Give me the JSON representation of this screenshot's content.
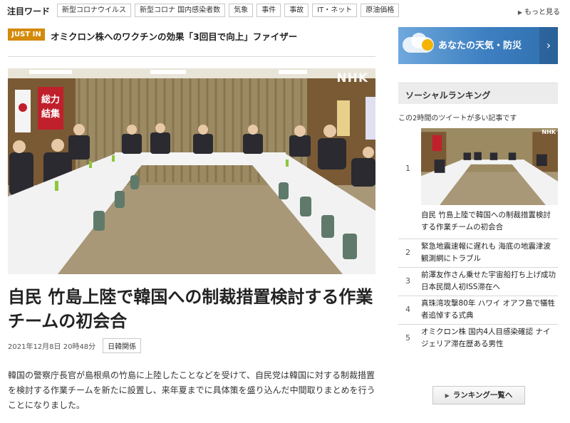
{
  "trending": {
    "label": "注目ワード",
    "tags": [
      "新型コロナウイルス",
      "新型コロナ 国内感染者数",
      "気象",
      "事件",
      "事故",
      "IT・ネット",
      "原油価格"
    ],
    "more": "もっと見る"
  },
  "just_in": {
    "badge": "JUST IN",
    "text": "オミクロン株へのワクチンの効果「3回目で向上」ファイザー"
  },
  "photo": {
    "logo": "NHK",
    "banner_lines": [
      "総力",
      "結集"
    ]
  },
  "article": {
    "headline": "自民 竹島上陸で韓国への制裁措置検討する作業チームの初会合",
    "date": "2021年12月8日 20時48分",
    "category": "日韓関係",
    "body": "韓国の警察庁長官が島根県の竹島に上陸したことなどを受けて、自民党は韓国に対する制裁措置を検討する作業チームを新たに設置し、来年夏までに具体策を盛り込んだ中間取りまとめを行うことになりました。"
  },
  "weather_banner": {
    "text": "あなたの天気・防災",
    "icon": "sun-cloud-icon",
    "arrow_icon": "chevron-right-icon"
  },
  "social_ranking": {
    "heading": "ソーシャルランキング",
    "subheading": "この2時間のツイートが多い記事です",
    "items": [
      {
        "rank": "1",
        "title": "自民 竹島上陸で韓国への制裁措置検討する作業チームの初会合"
      },
      {
        "rank": "2",
        "title": "緊急地震速報に遅れも 海底の地震津波観測網にトラブル"
      },
      {
        "rank": "3",
        "title": "前澤友作さん乗せた宇宙船打ち上げ成功 日本民間人初ISS滞在へ"
      },
      {
        "rank": "4",
        "title": "真珠湾攻撃80年 ハワイ オアフ島で犠牲者追悼する式典"
      },
      {
        "rank": "5",
        "title": "オミクロン株 国内4人目感染確認 ナイジェリア滞在歴ある男性"
      }
    ],
    "button": "ランキング一覧へ"
  },
  "colors": {
    "just_in_badge": "#d48a0a",
    "weather_banner": "#3d7fc1",
    "banner_red": "#c0202c"
  }
}
